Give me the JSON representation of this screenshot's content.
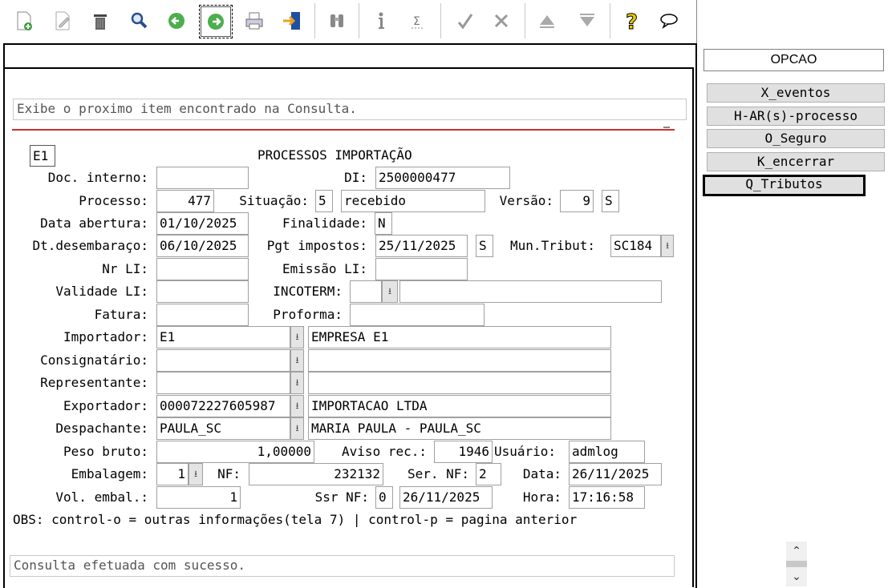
{
  "toolbar": {
    "buttons": [
      {
        "name": "new-document-icon",
        "glyph": "🗋"
      },
      {
        "name": "edit-icon",
        "glyph": "✎"
      },
      {
        "name": "trash-icon",
        "glyph": "🗑"
      },
      {
        "name": "search-icon",
        "glyph": "🔍"
      },
      {
        "name": "previous-icon",
        "glyph": "◀"
      },
      {
        "name": "next-icon",
        "glyph": "▶"
      },
      {
        "name": "print-icon",
        "glyph": "🖶"
      },
      {
        "name": "exit-icon",
        "glyph": "⇥"
      },
      {
        "name": "binoculars-icon",
        "glyph": "⌘"
      },
      {
        "name": "info-icon",
        "glyph": "i"
      },
      {
        "name": "sum-icon",
        "glyph": "Σ"
      },
      {
        "name": "confirm-icon",
        "glyph": "✓"
      },
      {
        "name": "cancel-icon",
        "glyph": "✗"
      },
      {
        "name": "up-icon",
        "glyph": "▲"
      },
      {
        "name": "down-icon",
        "glyph": "▼"
      },
      {
        "name": "help-icon",
        "glyph": "?"
      },
      {
        "name": "chat-icon",
        "glyph": "💬"
      }
    ]
  },
  "hint": "Exibe o proximo item encontrado na Consulta.",
  "form": {
    "code": "E1",
    "title": "PROCESSOS IMPORTAÇÃO",
    "labels": {
      "doc_interno": "Doc. interno:",
      "di": "DI:",
      "processo": "Processo:",
      "situacao": "Situação:",
      "versao": "Versão:",
      "data_abertura": "Data abertura:",
      "finalidade": "Finalidade:",
      "dt_desembaraco": "Dt.desembaraço:",
      "pgt_impostos": "Pgt impostos:",
      "mun_tribut": "Mun.Tribut:",
      "nr_li": "Nr LI:",
      "emissao_li": "Emissão LI:",
      "validade_li": "Validade LI:",
      "incoterm": "INCOTERM:",
      "fatura": "Fatura:",
      "proforma": "Proforma:",
      "importador": "Importador:",
      "consignatario": "Consignatário:",
      "representante": "Representante:",
      "exportador": "Exportador:",
      "despachante": "Despachante:",
      "peso_bruto": "Peso bruto:",
      "aviso_rec": "Aviso rec.:",
      "usuario": "Usuário:",
      "embalagem": "Embalagem:",
      "nf": "NF:",
      "ser_nf": "Ser. NF:",
      "data": "Data:",
      "vol_embal": "Vol. embal.:",
      "ssr_nf": "Ssr NF:",
      "hora": "Hora:"
    },
    "values": {
      "doc_interno": "",
      "di": "2500000477",
      "processo": "477",
      "situacao_code": "5",
      "situacao_desc": "recebido",
      "versao": "9",
      "versao_flag": "S",
      "data_abertura": "01/10/2025",
      "finalidade": "N",
      "dt_desembaraco": "06/10/2025",
      "pgt_impostos": "25/11/2025",
      "pgt_flag": "S",
      "mun_tribut": "SC184",
      "nr_li": "",
      "emissao_li": "",
      "validade_li": "",
      "incoterm": "",
      "incoterm_desc": "",
      "fatura": "",
      "proforma": "",
      "importador_code": "E1",
      "importador_name": "EMPRESA E1",
      "consignatario_code": "",
      "consignatario_name": "",
      "representante_code": "",
      "representante_name": "",
      "exportador_code": "000072227605987",
      "exportador_name": "IMPORTACAO LTDA",
      "despachante_code": "PAULA_SC",
      "despachante_name": "MARIA PAULA - PAULA_SC",
      "peso_bruto": "1,00000",
      "aviso_rec": "1946",
      "usuario": "admlog",
      "embalagem": "1",
      "nf": "232132",
      "ser_nf": "2",
      "data": "26/11/2025",
      "vol_embal": "1",
      "ssr_nf": "0",
      "ssr_data": "26/11/2025",
      "hora": "17:16:58"
    },
    "obs": "OBS: control-o = outras informações(tela 7) | control-p = pagina anterior"
  },
  "status": "Consulta efetuada com sucesso.",
  "side": {
    "opcao": "OPCAO",
    "buttons": [
      "X_eventos",
      "H-AR(s)-processo",
      "O_Seguro",
      "K_encerrar",
      "Q_Tributos"
    ]
  },
  "colors": {
    "accent_line": "#d03030",
    "button_bg": "#e0e0e0"
  }
}
